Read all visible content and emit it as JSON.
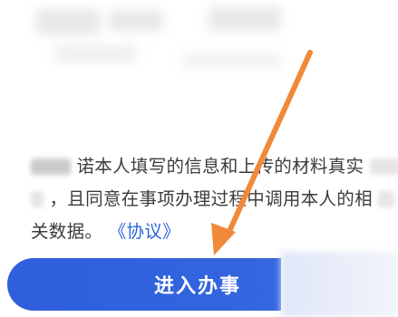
{
  "notice": {
    "line1_text": "诺本人填写的信息和上传的材料真实",
    "line2_text": "，且同意在事项办理过程中调用本人的相",
    "line3_text": "关数据。",
    "agreement_link": "《协议》"
  },
  "primary_button": {
    "label": "进入办事"
  },
  "colors": {
    "button": "#2f62dd",
    "link": "#2a64d8",
    "arrow": "#f0893a"
  }
}
